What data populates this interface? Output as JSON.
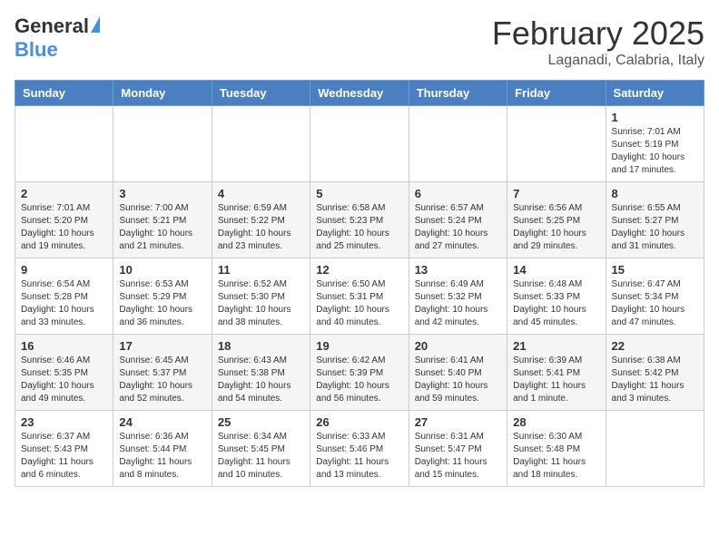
{
  "header": {
    "logo_general": "General",
    "logo_blue": "Blue",
    "month_title": "February 2025",
    "location": "Laganadi, Calabria, Italy"
  },
  "weekdays": [
    "Sunday",
    "Monday",
    "Tuesday",
    "Wednesday",
    "Thursday",
    "Friday",
    "Saturday"
  ],
  "weeks": [
    [
      {
        "day": "",
        "info": ""
      },
      {
        "day": "",
        "info": ""
      },
      {
        "day": "",
        "info": ""
      },
      {
        "day": "",
        "info": ""
      },
      {
        "day": "",
        "info": ""
      },
      {
        "day": "",
        "info": ""
      },
      {
        "day": "1",
        "info": "Sunrise: 7:01 AM\nSunset: 5:19 PM\nDaylight: 10 hours\nand 17 minutes."
      }
    ],
    [
      {
        "day": "2",
        "info": "Sunrise: 7:01 AM\nSunset: 5:20 PM\nDaylight: 10 hours\nand 19 minutes."
      },
      {
        "day": "3",
        "info": "Sunrise: 7:00 AM\nSunset: 5:21 PM\nDaylight: 10 hours\nand 21 minutes."
      },
      {
        "day": "4",
        "info": "Sunrise: 6:59 AM\nSunset: 5:22 PM\nDaylight: 10 hours\nand 23 minutes."
      },
      {
        "day": "5",
        "info": "Sunrise: 6:58 AM\nSunset: 5:23 PM\nDaylight: 10 hours\nand 25 minutes."
      },
      {
        "day": "6",
        "info": "Sunrise: 6:57 AM\nSunset: 5:24 PM\nDaylight: 10 hours\nand 27 minutes."
      },
      {
        "day": "7",
        "info": "Sunrise: 6:56 AM\nSunset: 5:25 PM\nDaylight: 10 hours\nand 29 minutes."
      },
      {
        "day": "8",
        "info": "Sunrise: 6:55 AM\nSunset: 5:27 PM\nDaylight: 10 hours\nand 31 minutes."
      }
    ],
    [
      {
        "day": "9",
        "info": "Sunrise: 6:54 AM\nSunset: 5:28 PM\nDaylight: 10 hours\nand 33 minutes."
      },
      {
        "day": "10",
        "info": "Sunrise: 6:53 AM\nSunset: 5:29 PM\nDaylight: 10 hours\nand 36 minutes."
      },
      {
        "day": "11",
        "info": "Sunrise: 6:52 AM\nSunset: 5:30 PM\nDaylight: 10 hours\nand 38 minutes."
      },
      {
        "day": "12",
        "info": "Sunrise: 6:50 AM\nSunset: 5:31 PM\nDaylight: 10 hours\nand 40 minutes."
      },
      {
        "day": "13",
        "info": "Sunrise: 6:49 AM\nSunset: 5:32 PM\nDaylight: 10 hours\nand 42 minutes."
      },
      {
        "day": "14",
        "info": "Sunrise: 6:48 AM\nSunset: 5:33 PM\nDaylight: 10 hours\nand 45 minutes."
      },
      {
        "day": "15",
        "info": "Sunrise: 6:47 AM\nSunset: 5:34 PM\nDaylight: 10 hours\nand 47 minutes."
      }
    ],
    [
      {
        "day": "16",
        "info": "Sunrise: 6:46 AM\nSunset: 5:35 PM\nDaylight: 10 hours\nand 49 minutes."
      },
      {
        "day": "17",
        "info": "Sunrise: 6:45 AM\nSunset: 5:37 PM\nDaylight: 10 hours\nand 52 minutes."
      },
      {
        "day": "18",
        "info": "Sunrise: 6:43 AM\nSunset: 5:38 PM\nDaylight: 10 hours\nand 54 minutes."
      },
      {
        "day": "19",
        "info": "Sunrise: 6:42 AM\nSunset: 5:39 PM\nDaylight: 10 hours\nand 56 minutes."
      },
      {
        "day": "20",
        "info": "Sunrise: 6:41 AM\nSunset: 5:40 PM\nDaylight: 10 hours\nand 59 minutes."
      },
      {
        "day": "21",
        "info": "Sunrise: 6:39 AM\nSunset: 5:41 PM\nDaylight: 11 hours\nand 1 minute."
      },
      {
        "day": "22",
        "info": "Sunrise: 6:38 AM\nSunset: 5:42 PM\nDaylight: 11 hours\nand 3 minutes."
      }
    ],
    [
      {
        "day": "23",
        "info": "Sunrise: 6:37 AM\nSunset: 5:43 PM\nDaylight: 11 hours\nand 6 minutes."
      },
      {
        "day": "24",
        "info": "Sunrise: 6:36 AM\nSunset: 5:44 PM\nDaylight: 11 hours\nand 8 minutes."
      },
      {
        "day": "25",
        "info": "Sunrise: 6:34 AM\nSunset: 5:45 PM\nDaylight: 11 hours\nand 10 minutes."
      },
      {
        "day": "26",
        "info": "Sunrise: 6:33 AM\nSunset: 5:46 PM\nDaylight: 11 hours\nand 13 minutes."
      },
      {
        "day": "27",
        "info": "Sunrise: 6:31 AM\nSunset: 5:47 PM\nDaylight: 11 hours\nand 15 minutes."
      },
      {
        "day": "28",
        "info": "Sunrise: 6:30 AM\nSunset: 5:48 PM\nDaylight: 11 hours\nand 18 minutes."
      },
      {
        "day": "",
        "info": ""
      }
    ]
  ]
}
